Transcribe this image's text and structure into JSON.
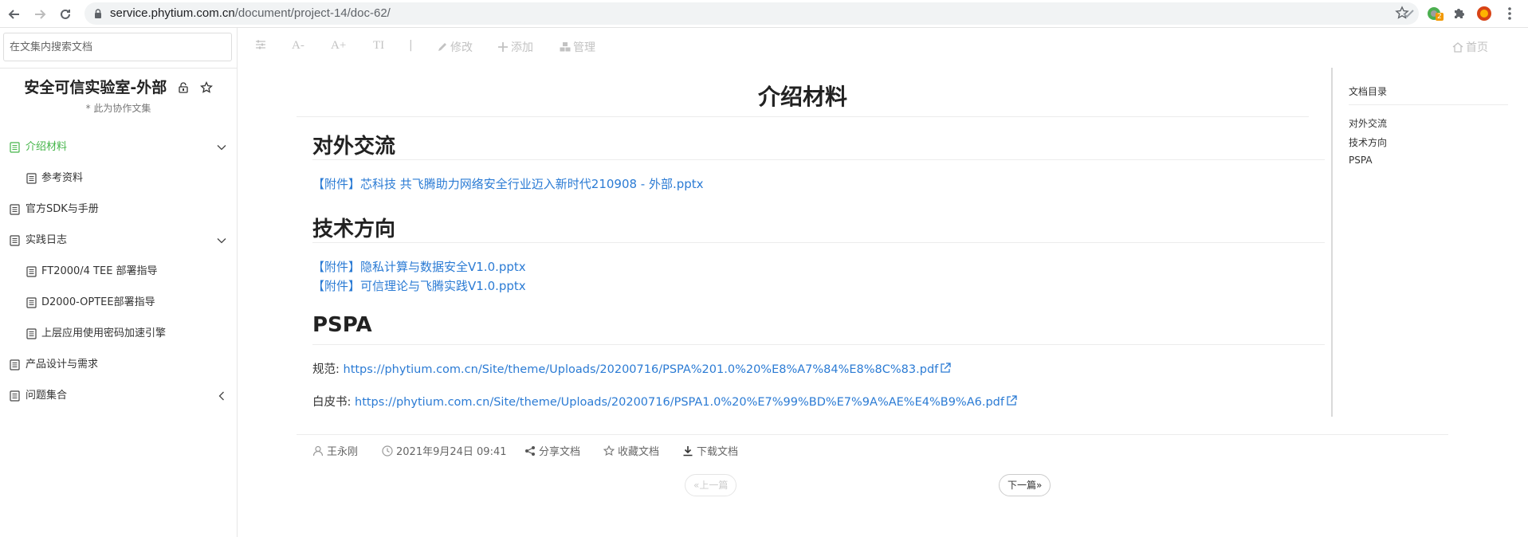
{
  "browser": {
    "url_host": "service.phytium.com.cn",
    "url_path": "/document/project-14/doc-62/",
    "ext_badge": "2"
  },
  "sidebar": {
    "search_placeholder": "在文集内搜索文档",
    "project_title": "安全可信实验室-外部",
    "project_sub": "* 此为协作文集",
    "items": [
      {
        "label": "介绍材料",
        "level": 0,
        "active": true,
        "chevron": "down"
      },
      {
        "label": "参考资料",
        "level": 1
      },
      {
        "label": "官方SDK与手册",
        "level": 0
      },
      {
        "label": "实践日志",
        "level": 0,
        "chevron": "down"
      },
      {
        "label": "FT2000/4 TEE 部署指导",
        "level": 1
      },
      {
        "label": "D2000-OPTEE部署指导",
        "level": 1
      },
      {
        "label": "上层应用使用密码加速引擎",
        "level": 1
      },
      {
        "label": "产品设计与需求",
        "level": 0
      },
      {
        "label": "问题集合",
        "level": 0,
        "chevron": "left"
      }
    ]
  },
  "toolbar": {
    "font_minus": "A-",
    "font_plus": "A+",
    "font_type": "TI",
    "divider": "|",
    "edit": "修改",
    "add": "添加",
    "manage": "管理",
    "home": "首页"
  },
  "doc": {
    "title": "介绍材料",
    "sections": [
      {
        "heading": "对外交流"
      },
      {
        "heading": "技术方向"
      },
      {
        "heading": "PSPA"
      }
    ],
    "link1": "【附件】芯科技 共飞腾助力网络安全行业迈入新时代210908 - 外部.pptx",
    "link2": "【附件】隐私计算与数据安全V1.0.pptx",
    "link3": "【附件】可信理论与飞腾实践V1.0.pptx",
    "spec_label": "规范: ",
    "spec_url": "https://phytium.com.cn/Site/theme/Uploads/20200716/PSPA%201.0%20%E8%A7%84%E8%8C%83.pdf",
    "white_label": "白皮书: ",
    "white_url": "https://phytium.com.cn/Site/theme/Uploads/20200716/PSPA1.0%20%E7%99%BD%E7%9A%AE%E4%B9%A6.pdf"
  },
  "toc": {
    "heading": "文档目录",
    "items": [
      "对外交流",
      "技术方向",
      "PSPA"
    ]
  },
  "meta": {
    "author": "王永刚",
    "datetime": "2021年9月24日 09:41",
    "share": "分享文档",
    "collect": "收藏文档",
    "download": "下载文档",
    "prev": "上一篇",
    "next": "下一篇"
  }
}
